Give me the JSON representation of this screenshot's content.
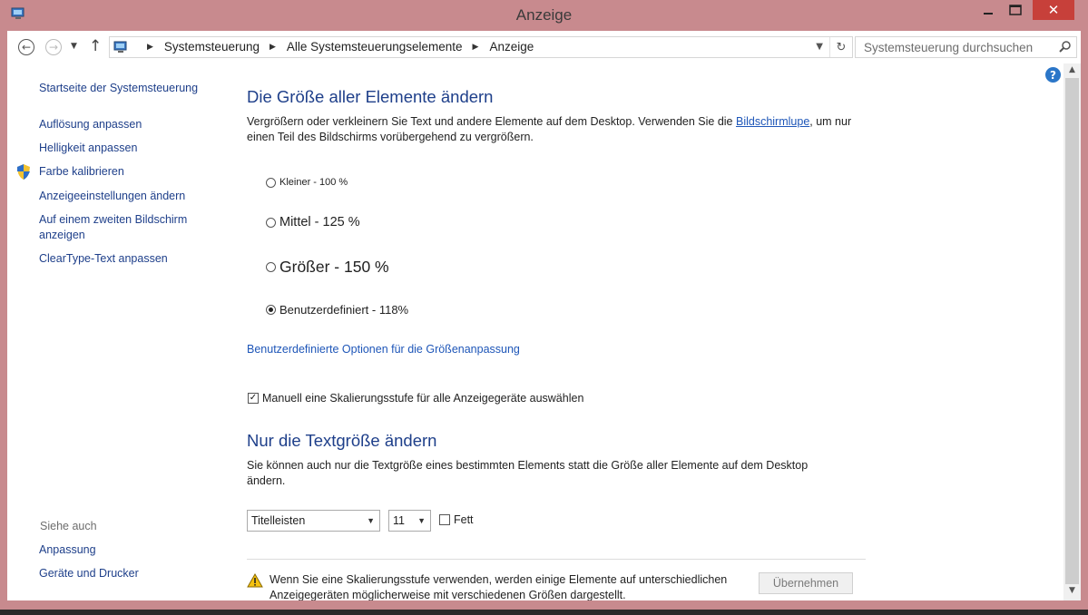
{
  "window": {
    "title": "Anzeige",
    "controls": {
      "minimize": "–",
      "maximize": "□",
      "close": "✕"
    }
  },
  "navbar": {
    "breadcrumbs": [
      "Systemsteuerung",
      "Alle Systemsteuerungselemente",
      "Anzeige"
    ],
    "search_placeholder": "Systemsteuerung durchsuchen"
  },
  "sidebar": {
    "home_link": "Startseite der Systemsteuerung",
    "links": [
      "Auflösung anpassen",
      "Helligkeit anpassen",
      "Farbe kalibrieren",
      "Anzeigeeinstellungen ändern",
      "Auf einem zweiten Bildschirm anzeigen",
      "ClearType-Text anpassen"
    ],
    "see_also_heading": "Siehe auch",
    "see_also_links": [
      "Anpassung",
      "Geräte und Drucker"
    ]
  },
  "main": {
    "size_heading": "Die Größe aller Elemente ändern",
    "size_desc_before": "Vergrößern oder verkleinern Sie Text und andere Elemente auf dem Desktop. Verwenden Sie die ",
    "size_desc_link": "Bildschirmlupe",
    "size_desc_after": ", um nur einen Teil des Bildschirms vorübergehend zu vergrößern.",
    "options": [
      {
        "label": "Kleiner - 100 %",
        "checked": false
      },
      {
        "label": "Mittel - 125 %",
        "checked": false
      },
      {
        "label": "Größer - 150 %",
        "checked": false
      },
      {
        "label": "Benutzerdefiniert - 118%",
        "checked": true
      }
    ],
    "custom_options_link": "Benutzerdefinierte Optionen für die Größenanpassung",
    "manual_scaling_label": "Manuell eine Skalierungsstufe für alle Anzeigegeräte auswählen",
    "manual_scaling_checked": true,
    "text_heading": "Nur die Textgröße ändern",
    "text_desc": "Sie können auch nur die Textgröße eines bestimmten Elements statt die Größe aller Elemente auf dem Desktop ändern.",
    "element_select_value": "Titelleisten",
    "size_select_value": "11",
    "bold_label": "Fett",
    "bold_checked": false,
    "warning_text": "Wenn Sie eine Skalierungsstufe verwenden, werden einige Elemente auf unterschiedlichen Anzeigegeräten möglicherweise mit verschiedenen Größen dargestellt.",
    "apply_button": "Übernehmen"
  },
  "icons": {
    "app": "control-panel-icon",
    "help": "?",
    "help_color": "#2b76c8",
    "warning": "warning-icon",
    "shield": "uac-shield-icon"
  },
  "colors": {
    "frame": "#c88a8e",
    "link": "#1e3f8a",
    "close": "#c7403a"
  }
}
